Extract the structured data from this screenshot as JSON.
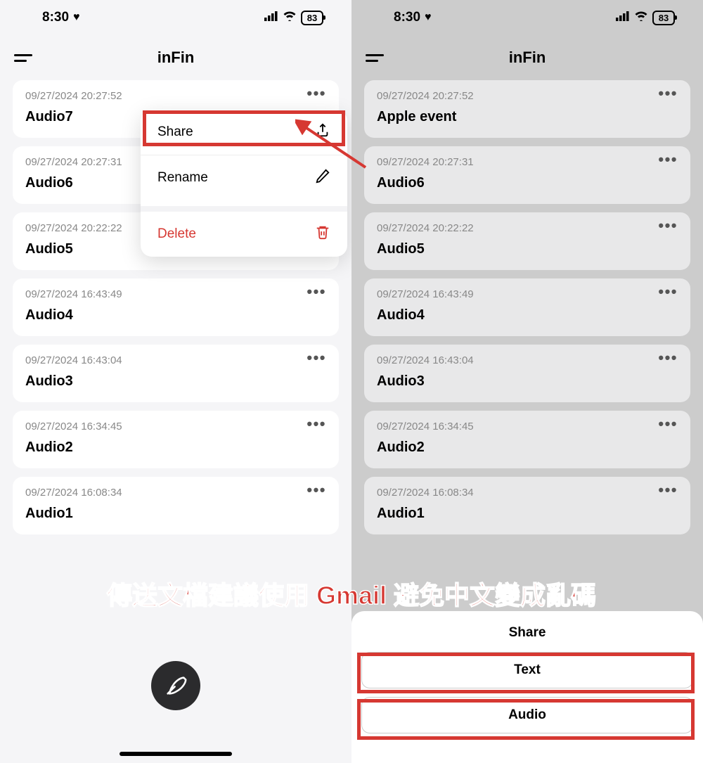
{
  "status": {
    "time": "8:30",
    "battery": "83"
  },
  "header": {
    "title": "inFin"
  },
  "left": {
    "items": [
      {
        "date": "09/27/2024 20:27:52",
        "title": "Audio7"
      },
      {
        "date": "09/27/2024 20:27:31",
        "title": "Audio6"
      },
      {
        "date": "09/27/2024 20:22:22",
        "title": "Audio5"
      },
      {
        "date": "09/27/2024 16:43:49",
        "title": "Audio4"
      },
      {
        "date": "09/27/2024 16:43:04",
        "title": "Audio3"
      },
      {
        "date": "09/27/2024 16:34:45",
        "title": "Audio2"
      },
      {
        "date": "09/27/2024 16:08:34",
        "title": "Audio1"
      }
    ],
    "menu": {
      "share": "Share",
      "rename": "Rename",
      "delete": "Delete"
    }
  },
  "right": {
    "items": [
      {
        "date": "09/27/2024 20:27:52",
        "title": "Apple event"
      },
      {
        "date": "09/27/2024 20:27:31",
        "title": "Audio6"
      },
      {
        "date": "09/27/2024 20:22:22",
        "title": "Audio5"
      },
      {
        "date": "09/27/2024 16:43:49",
        "title": "Audio4"
      },
      {
        "date": "09/27/2024 16:43:04",
        "title": "Audio3"
      },
      {
        "date": "09/27/2024 16:34:45",
        "title": "Audio2"
      },
      {
        "date": "09/27/2024 16:08:34",
        "title": "Audio1"
      }
    ],
    "sheet": {
      "title": "Share",
      "text": "Text",
      "audio": "Audio"
    }
  },
  "annotation": "傳送文檔建議使用 Gmail 避免中文變成亂碼"
}
